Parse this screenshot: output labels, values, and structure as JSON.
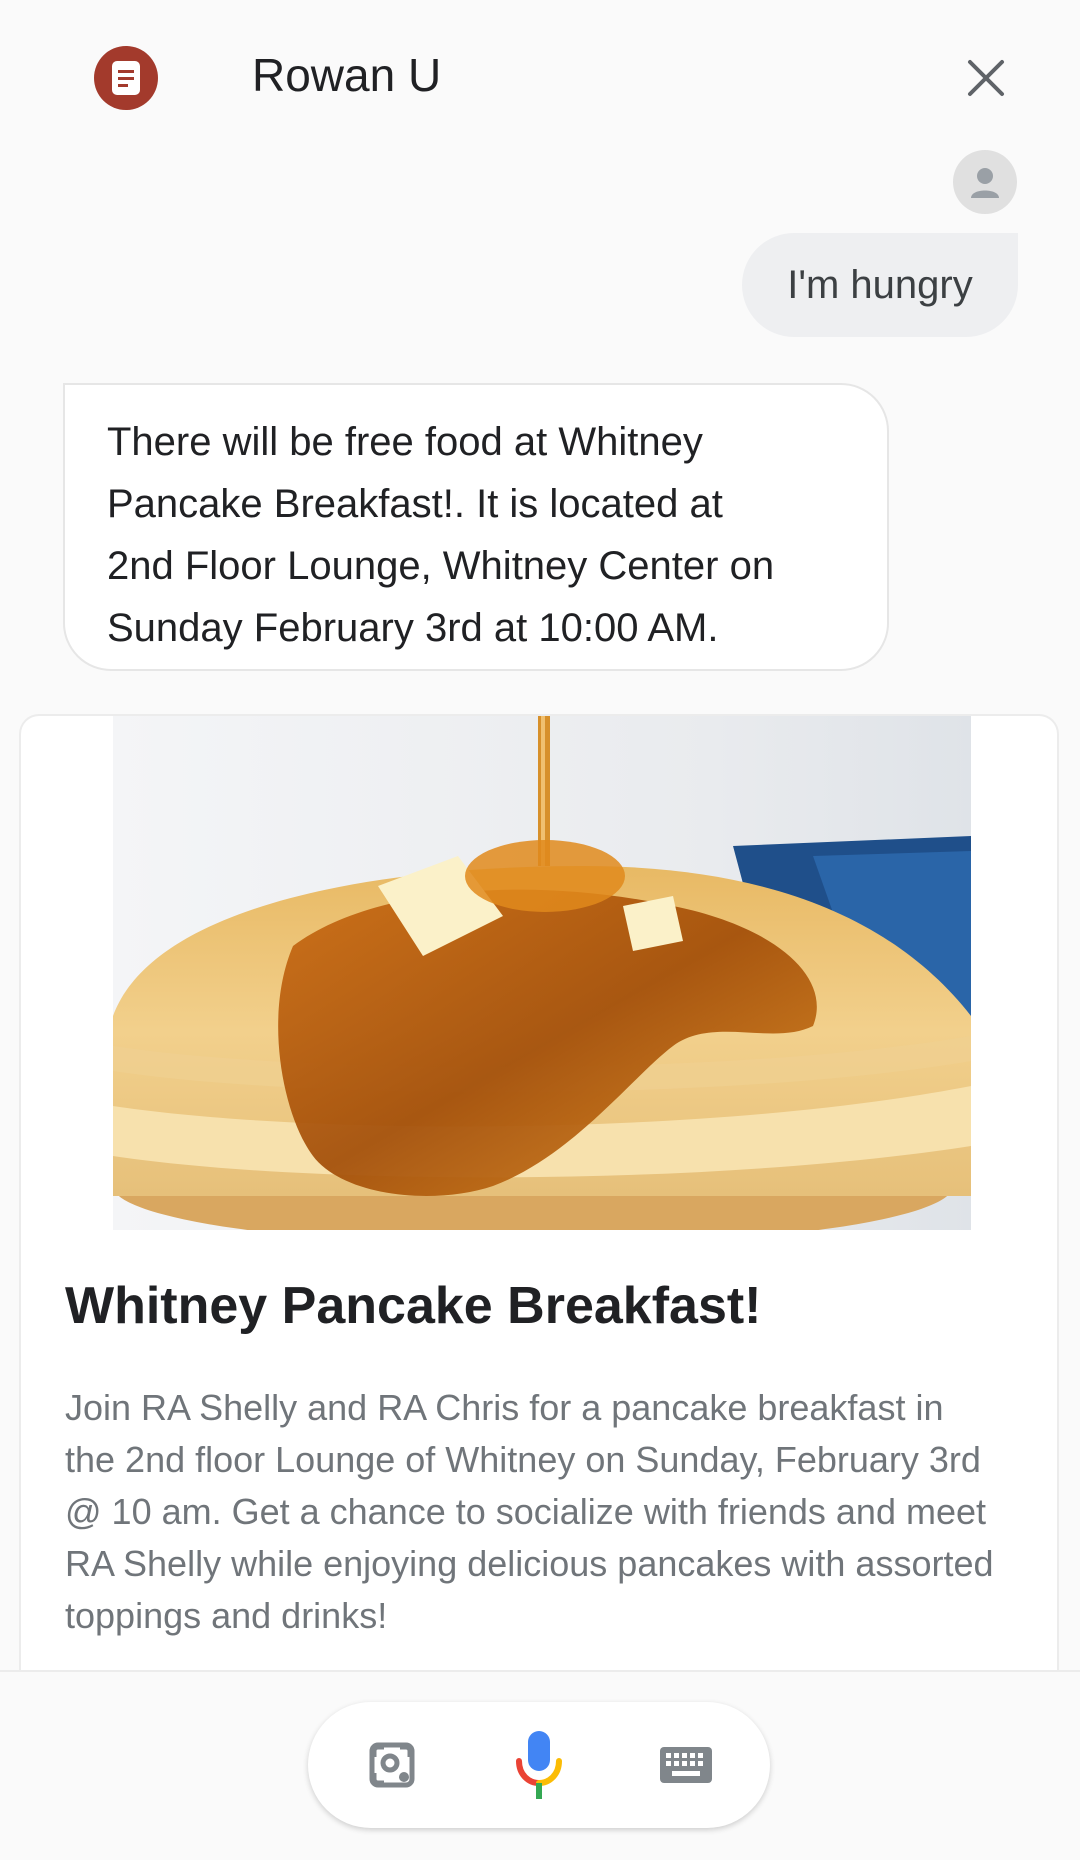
{
  "header": {
    "title": "Rowan U",
    "app_icon": "notepad-icon",
    "close_icon": "close-icon"
  },
  "conversation": {
    "user_avatar_icon": "person-icon",
    "user_message": "I'm hungry",
    "assistant_lines": [
      "There will be free food at Whitney",
      "Pancake Breakfast!. It is located at",
      "2nd Floor Lounge, Whitney Center on",
      "Sunday February 3rd at 10:00 AM."
    ]
  },
  "card": {
    "image": "pancake-stack-with-syrup",
    "title": "Whitney Pancake Breakfast!",
    "description_lines": [
      "Join RA Shelly and RA Chris for a pancake breakfast in",
      "the 2nd floor Lounge of Whitney on Sunday, February 3rd",
      "@ 10 am. Get a chance to socialize with friends and meet",
      "RA Shelly while enjoying delicious pancakes with assorted",
      "toppings and drinks!"
    ]
  },
  "input_bar": {
    "lens_icon": "lens-icon",
    "mic_icon": "microphone-icon",
    "keyboard_icon": "keyboard-icon"
  },
  "colors": {
    "brand": "#a33a2c",
    "google_blue": "#4285f4",
    "google_red": "#ea4335",
    "google_yellow": "#fbbc05",
    "google_green": "#34a853"
  }
}
